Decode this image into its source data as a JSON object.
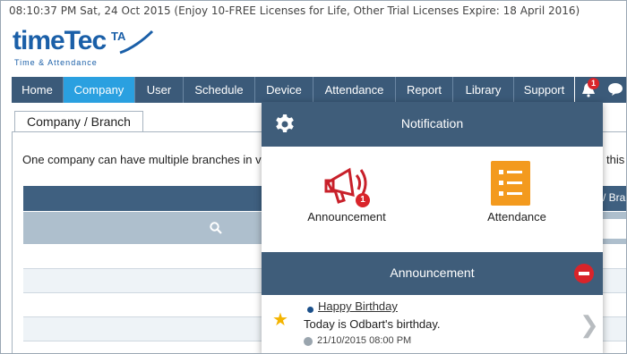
{
  "status_line": "08:10:37 PM   Sat, 24 Oct 2015  (Enjoy 10-FREE Licenses for Life, Other Trial Licenses Expire: 18 April 2016)",
  "logo": {
    "text": "timeTec",
    "suffix": "TA",
    "tagline": "Time & Attendance"
  },
  "nav": {
    "items": [
      "Home",
      "Company",
      "User",
      "Schedule",
      "Device",
      "Attendance",
      "Report",
      "Library",
      "Support"
    ],
    "active": "Company",
    "notification_count": "1"
  },
  "tab": {
    "label": "Company / Branch"
  },
  "description": "One company can have multiple branches in v",
  "description_right": "this t",
  "table": {
    "header_right": "/ Bra"
  },
  "notification_panel": {
    "title": "Notification",
    "items": [
      {
        "label": "Announcement",
        "badge": "1",
        "icon": "megaphone-icon"
      },
      {
        "label": "Attendance",
        "icon": "checklist-icon"
      }
    ],
    "announcement_header": "Announcement",
    "announcement": {
      "title": "Happy Birthday",
      "body": "Today is Odbart's birthday.",
      "time": "21/10/2015 08:00 PM"
    }
  },
  "colors": {
    "nav_bg": "#3b5a79",
    "nav_active": "#2aa0e0",
    "panel_header": "#3f5d7a",
    "badge_red": "#d9242a",
    "attendance_orange": "#f39a1e"
  }
}
